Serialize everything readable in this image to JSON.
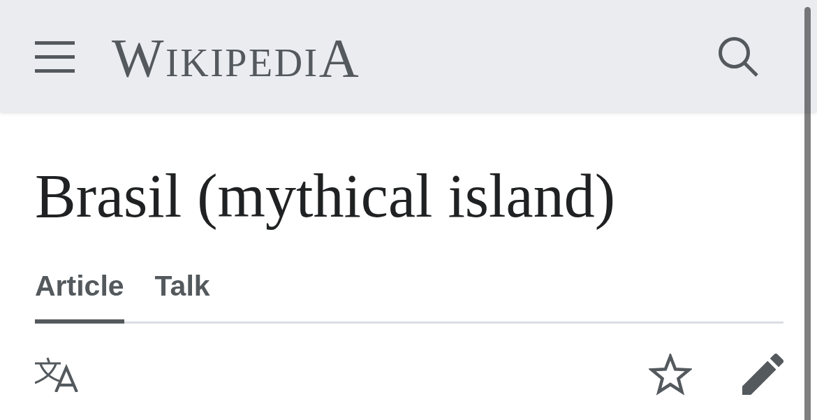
{
  "header": {
    "logo": "WIKIPEDIA"
  },
  "page": {
    "title": "Brasil (mythical island)"
  },
  "tabs": [
    {
      "label": "Article",
      "selected": true
    },
    {
      "label": "Talk",
      "selected": false
    }
  ]
}
